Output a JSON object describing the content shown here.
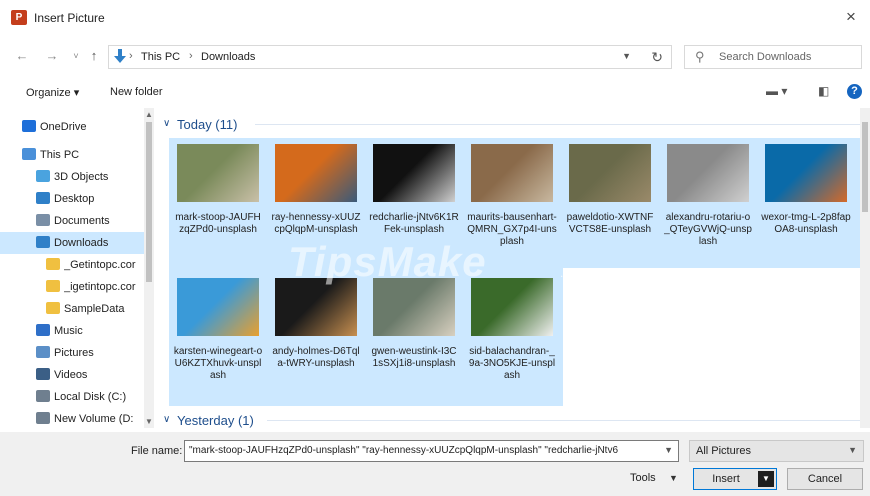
{
  "window": {
    "title": "Insert Picture",
    "app_icon_letter": "P",
    "close_glyph": "×"
  },
  "nav": {
    "back": "←",
    "forward": "→",
    "recent": "˅",
    "up": "↑"
  },
  "address": {
    "segments": [
      "This PC",
      "Downloads"
    ],
    "separator": "›"
  },
  "search": {
    "placeholder": "Search Downloads"
  },
  "toolbar": {
    "organize": "Organize ▾",
    "new_folder": "New folder",
    "help": "?"
  },
  "sidebar": {
    "items": [
      {
        "label": "OneDrive",
        "icon": "cloud-icon",
        "color": "#1e6fd9"
      },
      {
        "label": "This PC",
        "icon": "computer-icon",
        "color": "#4a90d9"
      },
      {
        "label": "3D Objects",
        "icon": "cube-icon",
        "color": "#4aa3df"
      },
      {
        "label": "Desktop",
        "icon": "desktop-icon",
        "color": "#2f80c8"
      },
      {
        "label": "Documents",
        "icon": "document-icon",
        "color": "#7a8fa6"
      },
      {
        "label": "Downloads",
        "icon": "download-icon",
        "color": "#2f80c8"
      },
      {
        "label": "_Getintopc.cor",
        "icon": "folder-icon",
        "color": "#f0c040"
      },
      {
        "label": "_igetintopc.cor",
        "icon": "folder-icon",
        "color": "#f0c040"
      },
      {
        "label": "SampleData",
        "icon": "folder-icon",
        "color": "#f0c040"
      },
      {
        "label": "Music",
        "icon": "music-icon",
        "color": "#2f6fc8"
      },
      {
        "label": "Pictures",
        "icon": "picture-icon",
        "color": "#5b8fc7"
      },
      {
        "label": "Videos",
        "icon": "video-icon",
        "color": "#3b5f86"
      },
      {
        "label": "Local Disk (C:)",
        "icon": "drive-icon",
        "color": "#6f7f8f"
      },
      {
        "label": "New Volume (D:",
        "icon": "drive-icon",
        "color": "#6f7f8f"
      }
    ]
  },
  "groups": {
    "today": {
      "label": "Today (11)"
    },
    "yesterday": {
      "label": "Yesterday (1)"
    }
  },
  "files": [
    {
      "name": "mark-stoop-JAUFHzqZPd0-unsplash",
      "img_colors": [
        "#7a8a5a",
        "#c9c0a8"
      ]
    },
    {
      "name": "ray-hennessy-xUUZcpQlqpM-unsplash",
      "img_colors": [
        "#d46a1c",
        "#3a5a7a"
      ]
    },
    {
      "name": "redcharlie-jNtv6K1RFek-unsplash",
      "img_colors": [
        "#111111",
        "#d0d0d0"
      ]
    },
    {
      "name": "maurits-bausenhart-QMRN_GX7p4I-unsplash",
      "img_colors": [
        "#8a6a4a",
        "#c8b8a0"
      ]
    },
    {
      "name": "paweldotio-XWTNFVCTS8E-unsplash",
      "img_colors": [
        "#6a6a4a",
        "#9a8a6a"
      ]
    },
    {
      "name": "alexandru-rotariu-o_QTeyGVWjQ-unsplash",
      "img_colors": [
        "#8a8a8a",
        "#d0d0d0"
      ]
    },
    {
      "name": "wexor-tmg-L-2p8fapOA8-unsplash",
      "img_colors": [
        "#0a6aa8",
        "#d46a2a"
      ]
    },
    {
      "name": "karsten-winegeart-oU6KZTXhuvk-unsplash",
      "img_colors": [
        "#3a9ad8",
        "#e8a030"
      ]
    },
    {
      "name": "andy-holmes-D6Tqla-tWRY-unsplash",
      "img_colors": [
        "#1a1a1a",
        "#c89050"
      ]
    },
    {
      "name": "gwen-weustink-I3C1sSXj1i8-unsplash",
      "img_colors": [
        "#6a7a6a",
        "#d8d0c0"
      ]
    },
    {
      "name": "sid-balachandran-_9a-3NO5KJE-unsplash",
      "img_colors": [
        "#3a6a2a",
        "#f0f0f0"
      ]
    }
  ],
  "watermark": {
    "main": "TipsMake",
    "small": ".com"
  },
  "footer": {
    "file_name_label": "File name:",
    "file_name_value": "\"mark-stoop-JAUFHzqZPd0-unsplash\" \"ray-hennessy-xUUZcpQlqpM-unsplash\" \"redcharlie-jNtv6",
    "file_type": "All Pictures",
    "tools": "Tools",
    "insert": "Insert",
    "cancel": "Cancel"
  },
  "colors": {
    "selection": "#cce8ff",
    "accent": "#0078d7",
    "group_header": "#1e4e8c"
  }
}
